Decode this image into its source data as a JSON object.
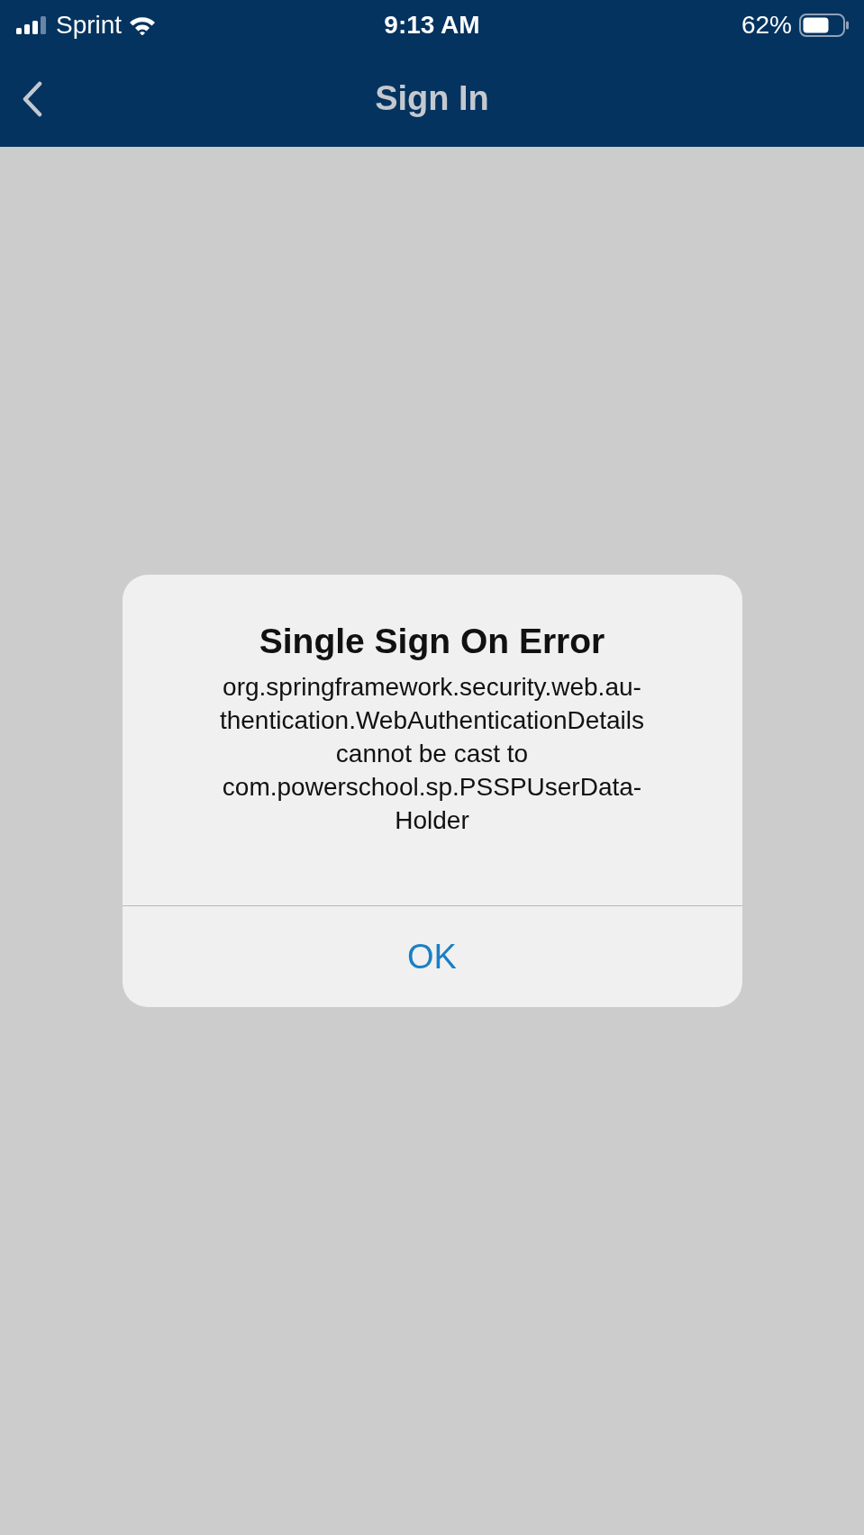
{
  "status_bar": {
    "carrier": "Sprint",
    "time": "9:13 AM",
    "battery": "62%"
  },
  "nav_bar": {
    "title": "Sign In"
  },
  "alert": {
    "title": "Single Sign On Error",
    "message": "org.springframework.security.web.au-\nthentication.WebAuthenticationDetails\ncannot be cast to\ncom.powerschool.sp.PSSPUserData-\nHolder",
    "buttons": [
      "OK"
    ]
  }
}
